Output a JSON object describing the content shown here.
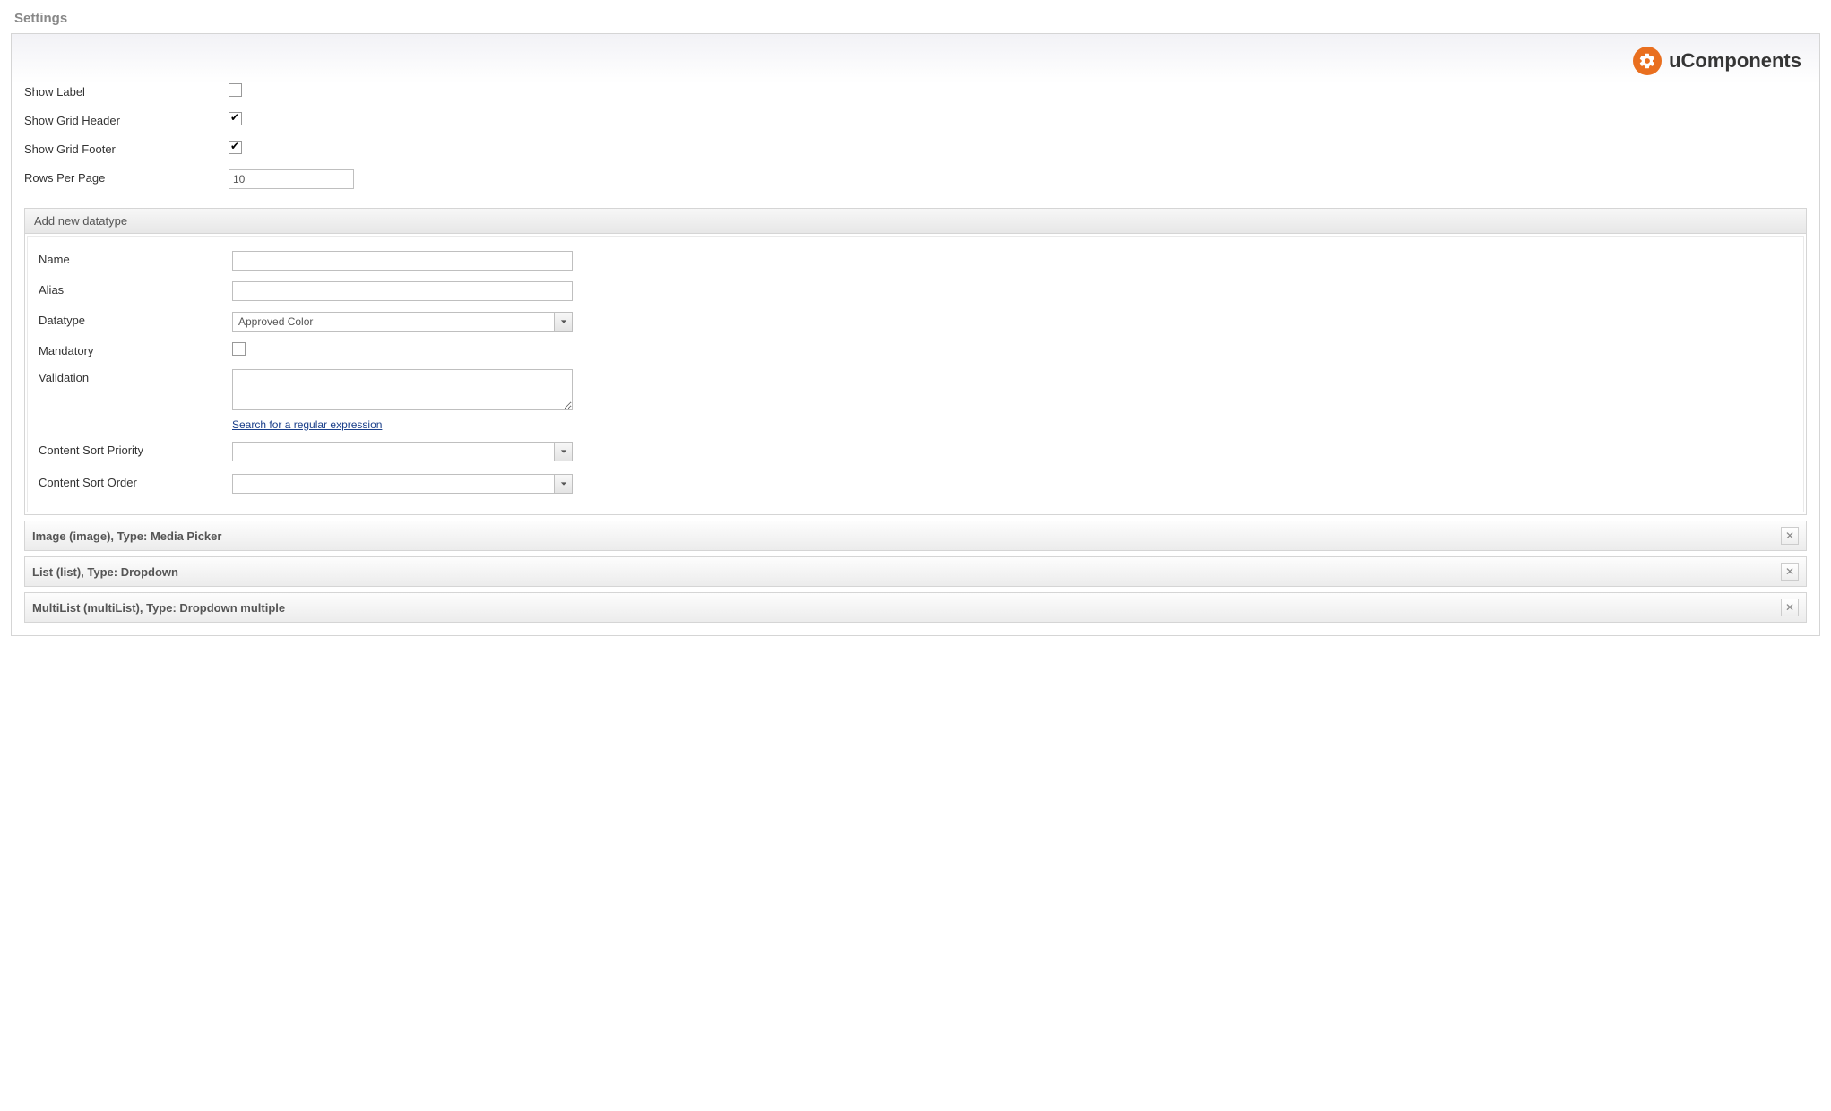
{
  "page": {
    "title": "Settings"
  },
  "logo": {
    "text": "uComponents"
  },
  "settings": {
    "showLabel": {
      "label": "Show Label",
      "checked": false
    },
    "showGridHeader": {
      "label": "Show Grid Header",
      "checked": true
    },
    "showGridFooter": {
      "label": "Show Grid Footer",
      "checked": true
    },
    "rowsPerPage": {
      "label": "Rows Per Page",
      "value": "10"
    }
  },
  "addDatatype": {
    "heading": "Add new datatype",
    "fields": {
      "name": {
        "label": "Name",
        "value": ""
      },
      "alias": {
        "label": "Alias",
        "value": ""
      },
      "datatype": {
        "label": "Datatype",
        "selected": "Approved Color"
      },
      "mandatory": {
        "label": "Mandatory",
        "checked": false
      },
      "validation": {
        "label": "Validation",
        "value": "",
        "helper": "Search for a regular expression"
      },
      "contentSortPriority": {
        "label": "Content Sort Priority",
        "selected": ""
      },
      "contentSortOrder": {
        "label": "Content Sort Order",
        "selected": ""
      }
    }
  },
  "existingDatatypes": [
    {
      "label": "Image (image), Type: Media Picker"
    },
    {
      "label": "List (list), Type: Dropdown"
    },
    {
      "label": "MultiList (multiList), Type: Dropdown multiple"
    }
  ]
}
